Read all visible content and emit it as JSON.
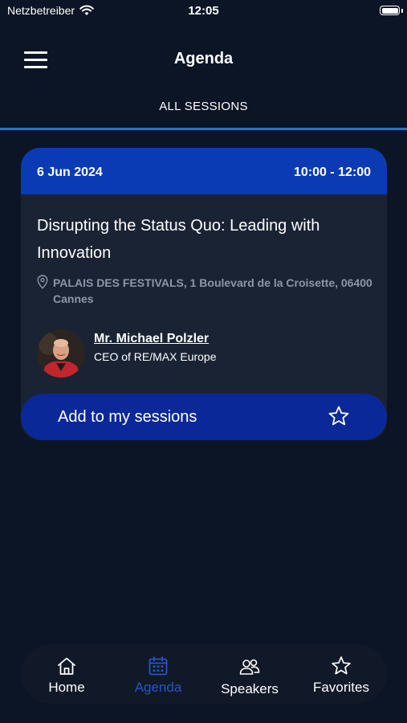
{
  "status_bar": {
    "carrier": "Netzbetreiber",
    "time": "12:05"
  },
  "header": {
    "title": "Agenda",
    "menu_icon": "hamburger-menu-icon"
  },
  "tabs": [
    {
      "label": "ALL SESSIONS",
      "active": true
    }
  ],
  "session": {
    "date": "6 Jun 2024",
    "time": "10:00 - 12:00",
    "title": "Disrupting the Status Quo: Leading with Innovation",
    "location": "PALAIS DES FESTIVALS, 1 Boulevard de la Croisette, 06400 Cannes",
    "speaker": {
      "name": "Mr. Michael Polzler",
      "role": "CEO of RE/MAX Europe"
    },
    "add_button_label": "Add to my sessions"
  },
  "bottom_nav": [
    {
      "label": "Home",
      "icon": "home-icon",
      "active": false
    },
    {
      "label": "Agenda",
      "icon": "calendar-icon",
      "active": true
    },
    {
      "label": "Speakers",
      "icon": "people-icon",
      "active": false
    },
    {
      "label": "Favorites",
      "icon": "star-icon",
      "active": false
    }
  ],
  "colors": {
    "background": "#0c1525",
    "card": "#1a2333",
    "card_header": "#0a3bb5",
    "button": "#0b2899",
    "accent": "#2a71d0",
    "active_nav": "#2456c9"
  }
}
